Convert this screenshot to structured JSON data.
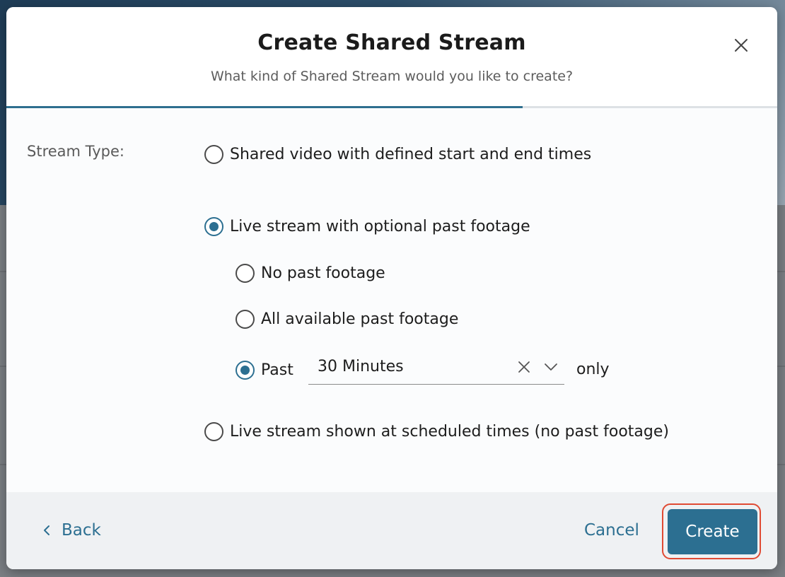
{
  "dialog": {
    "title": "Create Shared Stream",
    "subtitle": "What kind of Shared Stream would you like to create?",
    "progress_fraction": 0.67
  },
  "form": {
    "stream_type_label": "Stream Type:",
    "options": {
      "shared_video": {
        "label": "Shared video with defined start and end times",
        "selected": false
      },
      "live_stream": {
        "label": "Live stream with optional past footage",
        "selected": true
      },
      "no_past": {
        "label": "No past footage",
        "selected": false
      },
      "all_past": {
        "label": "All available past footage",
        "selected": false
      },
      "past": {
        "label": "Past",
        "selected": true
      },
      "scheduled": {
        "label": "Live stream shown at scheduled times (no past footage)",
        "selected": false
      }
    },
    "past_duration": {
      "value": "30 Minutes"
    },
    "only_label": "only"
  },
  "footer": {
    "back_label": "Back",
    "cancel_label": "Cancel",
    "create_label": "Create"
  },
  "colors": {
    "accent": "#2c6f91",
    "highlight_ring": "#e04a33"
  },
  "icons": {
    "close": "close-icon",
    "back": "chevron-left-icon",
    "clear": "clear-icon",
    "dropdown": "chevron-down-icon"
  }
}
